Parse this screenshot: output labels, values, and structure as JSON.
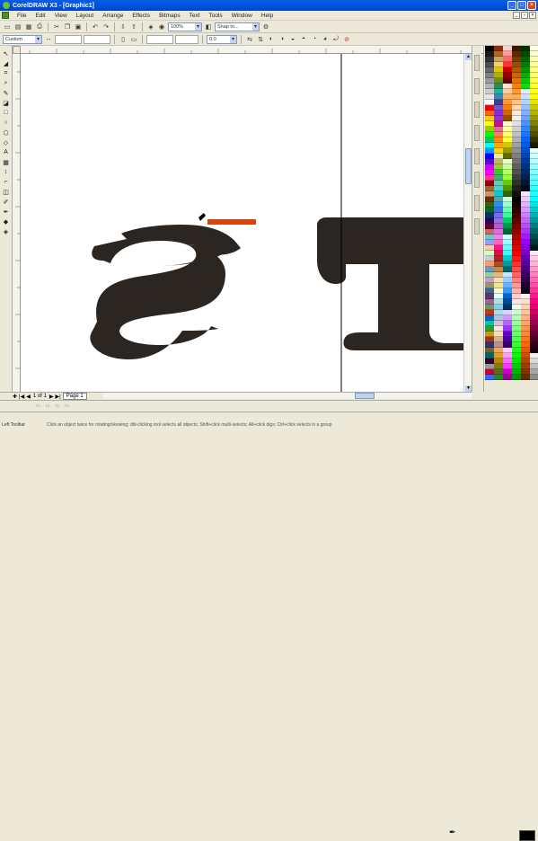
{
  "window": {
    "title": "CorelDRAW X3 - [Graphic1]"
  },
  "menu": {
    "items": [
      "File",
      "Edit",
      "View",
      "Layout",
      "Arrange",
      "Effects",
      "Bitmaps",
      "Text",
      "Tools",
      "Window",
      "Help"
    ]
  },
  "toolbar1": {
    "zoom_value": "100%",
    "snap_value": "Snap to..."
  },
  "property_bar": {
    "paper_value": "Custom",
    "units_value": "0.0"
  },
  "nav": {
    "page_count": "1 of 1",
    "page_tab": "Page 1"
  },
  "status": {
    "hint": "Click an object twice for rotating/skewing; dbl-clicking tool selects all objects; Shift+click multi-selects; Alt+click digs; Ctrl+click selects in a group",
    "left_text": "Left Toolbar"
  },
  "canvas": {
    "text": "ST",
    "text_color": "#2b2622",
    "highlight_color": "#d64510",
    "guideline_color": "#000000"
  },
  "palette_colors": [
    [
      "#000000",
      "#1a1a1a",
      "#333333",
      "#4d4d4d",
      "#666666",
      "#808080",
      "#999999",
      "#b3b3b3",
      "#cccccc",
      "#e6e6e6",
      "#ffffff",
      "#ff0000",
      "#ff6600",
      "#ffcc00",
      "#ffff00",
      "#99cc00",
      "#00ff00",
      "#00cc66",
      "#00ffff",
      "#0099ff",
      "#0000ff",
      "#6600cc",
      "#cc00ff",
      "#ff00ff",
      "#ff3399",
      "#990000",
      "#996633",
      "#cc9966",
      "#663300",
      "#336600",
      "#006633",
      "#003366",
      "#330066",
      "#660033",
      "#cc6666",
      "#66cccc",
      "#9999ff",
      "#ffcc99",
      "#ccffcc",
      "#cccccc",
      "#ff9966",
      "#6699cc",
      "#99cc99",
      "#cc99cc",
      "#999966",
      "#336699",
      "#663366",
      "#996699",
      "#669966",
      "#cc3300",
      "#0066cc",
      "#00cc99",
      "#339933",
      "#cc9900",
      "#993333",
      "#333366",
      "#666633",
      "#006666",
      "#330033",
      "#999999",
      "#cc0033",
      "#3366ff"
    ],
    [
      "#8c2e0b",
      "#b5651d",
      "#c8a165",
      "#f2d16b",
      "#e3c400",
      "#a9b400",
      "#6b8e23",
      "#2e8b57",
      "#20b2aa",
      "#4682b4",
      "#483d8b",
      "#6a5acd",
      "#8a2be2",
      "#9932cc",
      "#c71585",
      "#db7093",
      "#ff7f50",
      "#ff8c00",
      "#ffa500",
      "#ffd700",
      "#eee8aa",
      "#bdb76b",
      "#9acd32",
      "#32cd32",
      "#3cb371",
      "#66cdaa",
      "#48d1cc",
      "#00ced1",
      "#5f9ea0",
      "#1e90ff",
      "#4169e1",
      "#7b68ee",
      "#9370db",
      "#ba55d3",
      "#da70d6",
      "#ee82ee",
      "#ff69b4",
      "#ff1493",
      "#dc143c",
      "#b22222",
      "#a0522d",
      "#cd853f",
      "#deb887",
      "#f5deb3",
      "#f0e68c",
      "#fafad2",
      "#e0ffff",
      "#b0e0e6",
      "#87ceeb",
      "#add8e6",
      "#b0c4de",
      "#d8bfd8",
      "#ffe4e1",
      "#ffdab9",
      "#d2b48c",
      "#bc8f8f",
      "#f4a460",
      "#daa520",
      "#b8860b",
      "#808000",
      "#556b2f",
      "#228b22"
    ],
    [
      "#ffcccc",
      "#ff9999",
      "#ff6666",
      "#ff3333",
      "#cc0000",
      "#990000",
      "#660000",
      "#ffe5cc",
      "#ffcc99",
      "#ffb266",
      "#ff9933",
      "#ff8000",
      "#cc6600",
      "#994c00",
      "#ffffcc",
      "#ffff99",
      "#ffff66",
      "#ffff33",
      "#cccc00",
      "#999900",
      "#666600",
      "#e5ffcc",
      "#ccff99",
      "#b2ff66",
      "#99ff33",
      "#66cc00",
      "#4c9900",
      "#336600",
      "#ccffe5",
      "#99ffcc",
      "#66ffb2",
      "#33ff99",
      "#00cc66",
      "#00994c",
      "#006633",
      "#ccffff",
      "#99ffff",
      "#66ffff",
      "#33ffff",
      "#00cccc",
      "#009999",
      "#006666",
      "#cce5ff",
      "#99ccff",
      "#66b2ff",
      "#3399ff",
      "#0066cc",
      "#004c99",
      "#003366",
      "#e5ccff",
      "#cc99ff",
      "#b266ff",
      "#9933ff",
      "#6600cc",
      "#4c0099",
      "#330066",
      "#ffccff",
      "#ff99ff",
      "#ff66ff",
      "#ff33ff",
      "#cc00cc",
      "#990099"
    ],
    [
      "#3d1a00",
      "#5c2b00",
      "#7a3d00",
      "#994d00",
      "#b35900",
      "#cc6600",
      "#e67300",
      "#ff8000",
      "#ff9933",
      "#ffad5c",
      "#ffc285",
      "#ffd6ad",
      "#ffebd6",
      "#f0f0f0",
      "#e0e0e0",
      "#d0d0d0",
      "#c0c0c0",
      "#b0b0b0",
      "#a0a0a0",
      "#909090",
      "#808080",
      "#707070",
      "#606060",
      "#505050",
      "#404040",
      "#303030",
      "#202020",
      "#101010",
      "#000000",
      "#1a0000",
      "#330000",
      "#4d0000",
      "#660000",
      "#800000",
      "#990000",
      "#b30000",
      "#cc0000",
      "#e60000",
      "#ff0000",
      "#ff1a1a",
      "#ff3333",
      "#ff4d4d",
      "#ff6666",
      "#ff8080",
      "#ff9999",
      "#ffb3b3",
      "#ffcccc",
      "#ffe6e6",
      "#e6ffe6",
      "#ccffcc",
      "#b3ffb3",
      "#99ff99",
      "#80ff80",
      "#66ff66",
      "#4dff4d",
      "#33ff33",
      "#1aff1a",
      "#00ff00",
      "#00e600",
      "#00cc00",
      "#00b300",
      "#009900"
    ],
    [
      "#003300",
      "#004d00",
      "#006600",
      "#008000",
      "#009900",
      "#00b300",
      "#00cc00",
      "#00e600",
      "#e6f0ff",
      "#cce0ff",
      "#b3d1ff",
      "#99c2ff",
      "#80b3ff",
      "#66a3ff",
      "#4d94ff",
      "#3385ff",
      "#1a75ff",
      "#0066ff",
      "#005ce6",
      "#0052cc",
      "#0047b3",
      "#003d99",
      "#003380",
      "#002966",
      "#001f4d",
      "#001433",
      "#000a1a",
      "#f5e6ff",
      "#ebccff",
      "#e0b3ff",
      "#d699ff",
      "#cc80ff",
      "#c266ff",
      "#b84dff",
      "#ad33ff",
      "#a31aff",
      "#9900ff",
      "#8a00e6",
      "#7a00cc",
      "#6b00b3",
      "#5c0099",
      "#4d0080",
      "#3d0066",
      "#2e004d",
      "#1f0033",
      "#0f001a",
      "#fff0e6",
      "#ffe0cc",
      "#ffd1b3",
      "#ffc299",
      "#ffb380",
      "#ffa366",
      "#ff944d",
      "#ff8533",
      "#ff751a",
      "#ff6600",
      "#e65c00",
      "#cc5200",
      "#b34700",
      "#993d00",
      "#803300",
      "#662900"
    ],
    [
      "#ffffe6",
      "#ffffcc",
      "#ffffb3",
      "#ffff99",
      "#ffff80",
      "#ffff66",
      "#ffff4d",
      "#ffff33",
      "#ffff1a",
      "#ffff00",
      "#e6e600",
      "#cccc00",
      "#b3b300",
      "#999900",
      "#808000",
      "#666600",
      "#4d4d00",
      "#333300",
      "#1a1a00",
      "#e6ffff",
      "#ccffff",
      "#b3ffff",
      "#99ffff",
      "#80ffff",
      "#66ffff",
      "#4dffff",
      "#33ffff",
      "#1affff",
      "#00ffff",
      "#00e6e6",
      "#00cccc",
      "#00b3b3",
      "#009999",
      "#008080",
      "#006666",
      "#004d4d",
      "#003333",
      "#001a1a",
      "#ffe6f2",
      "#ffcce6",
      "#ffb3d9",
      "#ff99cc",
      "#ff80bf",
      "#ff66b3",
      "#ff4da6",
      "#ff3399",
      "#ff1a8c",
      "#ff0080",
      "#e60073",
      "#cc0066",
      "#b30059",
      "#99004d",
      "#800040",
      "#660033",
      "#4d0026",
      "#33001a",
      "#1a000d",
      "#f2f2f2",
      "#d9d9d9",
      "#bfbfbf",
      "#a6a6a6",
      "#8c8c8c"
    ]
  ]
}
